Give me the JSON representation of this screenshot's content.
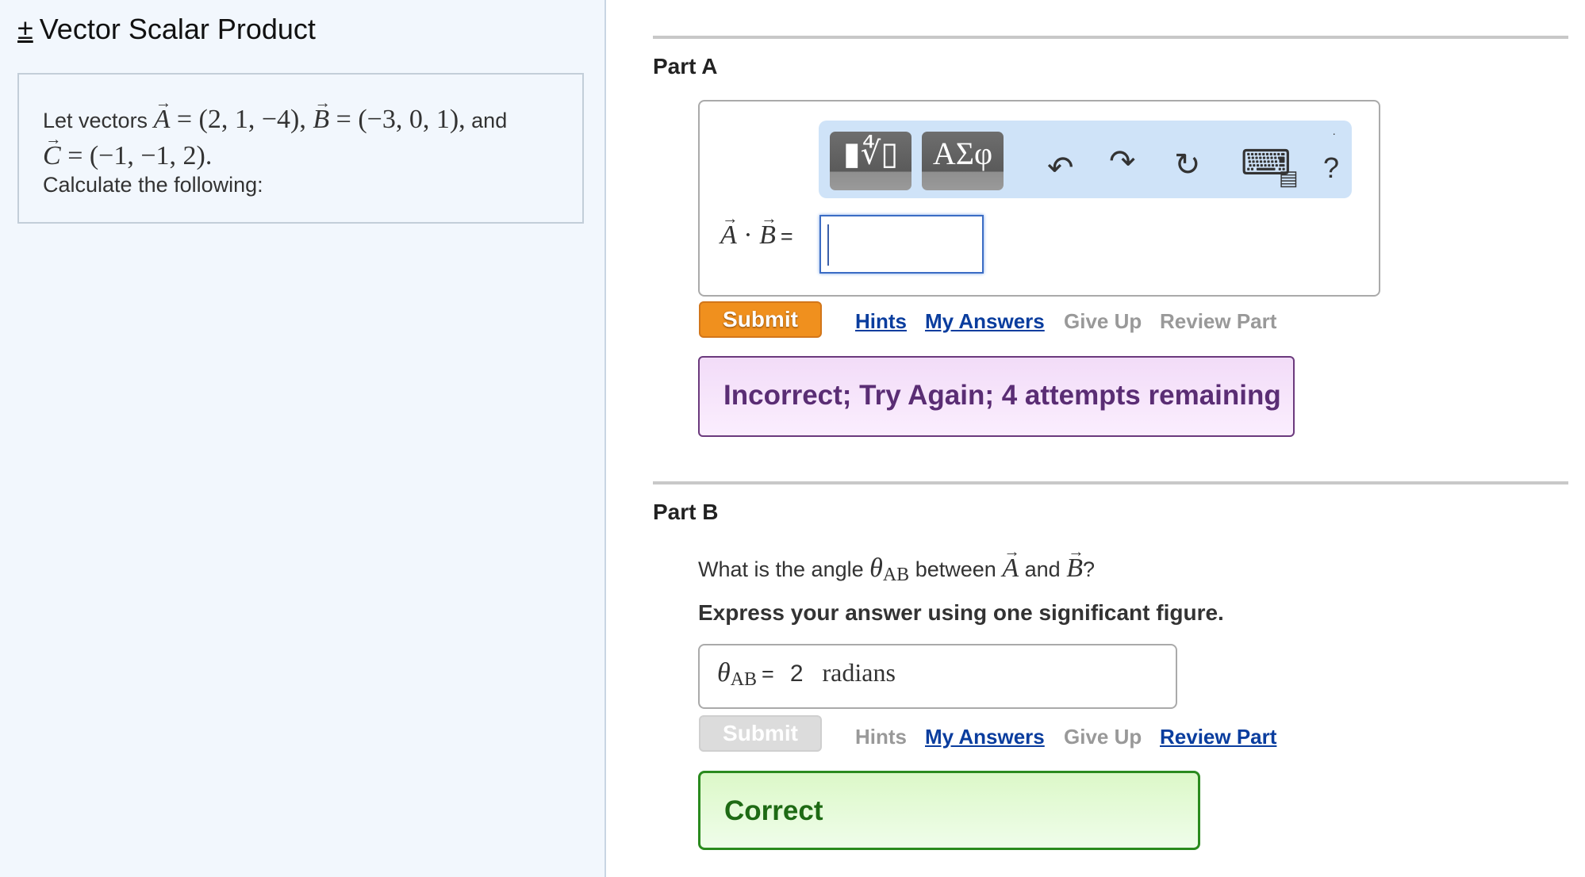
{
  "sidebar": {
    "title_prefix": "±",
    "title": "Vector Scalar Product",
    "problem": {
      "intro": "Let vectors",
      "vector_a_name": "A",
      "vector_a_value": "= (2, 1, −4),",
      "vector_b_name": "B",
      "vector_b_value": "= (−3, 0, 1),",
      "and": "and",
      "vector_c_name": "C",
      "vector_c_value": "= (−1, −1, 2).",
      "instruction": "Calculate the following:"
    }
  },
  "part_a": {
    "title": "Part A",
    "toolbar": {
      "templates_glyph": "▮∜▯",
      "symbols_glyph": "ΑΣφ",
      "undo_glyph": "↶",
      "redo_glyph": "↷",
      "reset_glyph": "↻",
      "keyboard_glyph": "⌨",
      "shortcuts_glyph": "▤",
      "help_glyph": "?",
      "dot": "·"
    },
    "label_vec_a": "A",
    "label_dot": "·",
    "label_vec_b": "B",
    "label_eq": "=",
    "answer_value": "",
    "submit_label": "Submit",
    "links": {
      "hints": "Hints",
      "my_answers": "My Answers",
      "give_up": "Give Up",
      "review_part": "Review Part"
    },
    "feedback": "Incorrect; Try Again; 4 attempts remaining"
  },
  "part_b": {
    "title": "Part B",
    "question_pre": "What is the angle",
    "theta": "θ",
    "theta_sub": "AB",
    "question_mid": "between",
    "vec_a": "A",
    "and": "and",
    "vec_b": "B",
    "question_end": "?",
    "instruction": "Express your answer using one significant figure.",
    "answer_label_theta": "θ",
    "answer_label_sub": "AB",
    "answer_eq": "=",
    "answer_value": "2",
    "answer_unit": "radians",
    "submit_label": "Submit",
    "links": {
      "hints": "Hints",
      "my_answers": "My Answers",
      "give_up": "Give Up",
      "review_part": "Review Part"
    },
    "feedback": "Correct"
  },
  "colors": {
    "submit_active": "#f0901e",
    "link_active": "#0a3d9e",
    "link_disabled": "#999999",
    "incorrect_text": "#5a2d74",
    "correct_text": "#1e6a14"
  }
}
